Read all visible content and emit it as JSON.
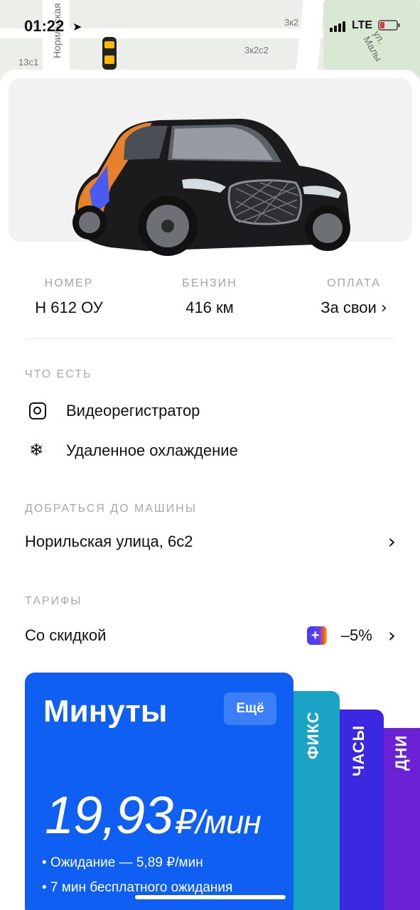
{
  "status_bar": {
    "time": "01:22",
    "network": "LTE"
  },
  "map": {
    "labels": [
      "13с1",
      "3к2",
      "3к2с2"
    ],
    "streets": [
      "Норильская",
      "ул. Малы"
    ]
  },
  "car_info": {
    "number": {
      "label": "НОМЕР",
      "value": "Н 612 ОУ"
    },
    "fuel": {
      "label": "БЕНЗИН",
      "value": "416 км"
    },
    "payment": {
      "label": "ОПЛАТА",
      "value": "За свои"
    }
  },
  "features": {
    "title": "ЧТО ЕСТЬ",
    "items": [
      {
        "label": "Видеорегистратор",
        "icon": "camera-icon"
      },
      {
        "label": "Удаленное охлаждение",
        "icon": "snowflake-icon"
      }
    ]
  },
  "route": {
    "title": "ДОБРАТЬСЯ ДО МАШИНЫ",
    "address": "Норильская улица, 6с2"
  },
  "tariffs": {
    "title": "ТАРИФЫ",
    "discount_row": {
      "label": "Со скидкой",
      "badge": "+",
      "value": "–5%"
    },
    "main": {
      "name": "Минуты",
      "more": "Ещё",
      "price": "19,93",
      "unit": "₽/мин",
      "lines": [
        "• Ожидание — 5,89 ₽/мин",
        "• 7 мин бесплатного ожидания"
      ]
    },
    "tabs": [
      "ФИКС",
      "ЧАСЫ",
      "ДНИ"
    ]
  },
  "colors": {
    "main_card": "#0e5ff2",
    "fix": "#1ba3c6",
    "hours": "#3c28e0",
    "days": "#6b22d4"
  }
}
